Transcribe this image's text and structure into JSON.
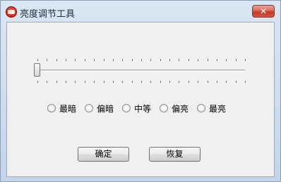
{
  "window": {
    "title": "亮度调节工具",
    "close_glyph": "✕",
    "app_icon": "red-round-app-icon"
  },
  "brightness_slider": {
    "value": 0,
    "min": 0,
    "max": 22,
    "tick_count": 23
  },
  "brightness_options": [
    {
      "label": "最暗",
      "checked": false
    },
    {
      "label": "偏暗",
      "checked": false
    },
    {
      "label": "中等",
      "checked": false
    },
    {
      "label": "偏亮",
      "checked": false
    },
    {
      "label": "最亮",
      "checked": false
    }
  ],
  "buttons": {
    "ok_label": "确定",
    "restore_label": "恢复"
  },
  "colors": {
    "close_button": "#c4392a",
    "client_background": "#f0f0f0",
    "title_bar": "#c4d5e9"
  }
}
